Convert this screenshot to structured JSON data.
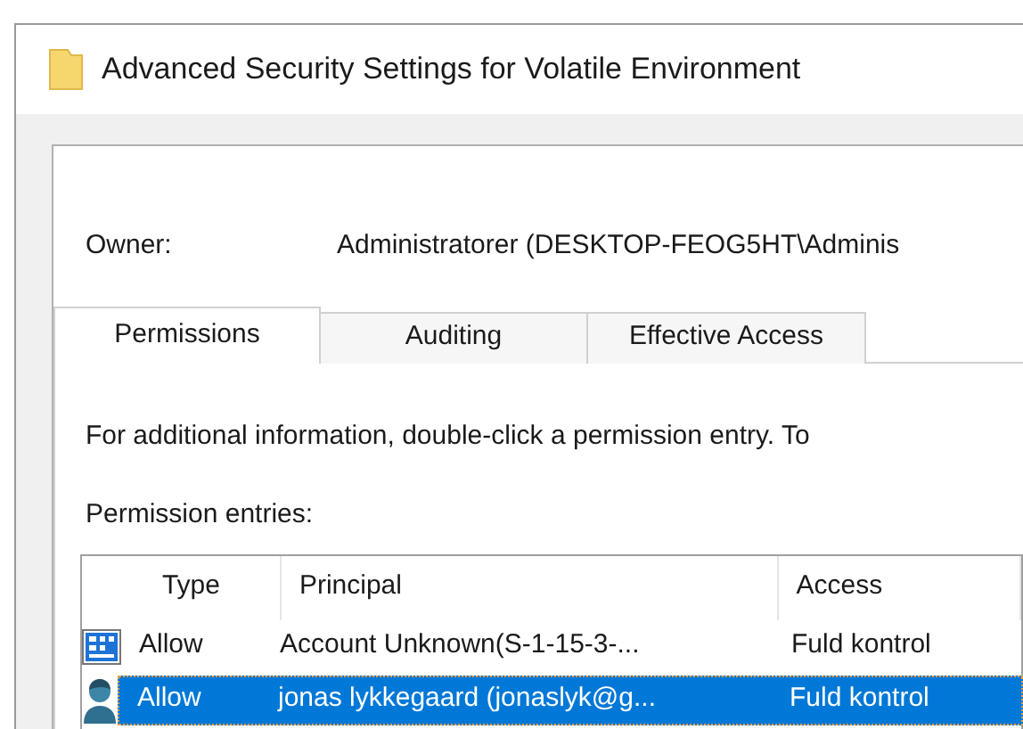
{
  "window": {
    "title": "Advanced Security Settings for Volatile Environment"
  },
  "owner": {
    "label": "Owner:",
    "value": "Administratorer (DESKTOP-FEOG5HT\\Adminis"
  },
  "tabs": [
    {
      "label": "Permissions",
      "selected": true
    },
    {
      "label": "Auditing",
      "selected": false
    },
    {
      "label": "Effective Access",
      "selected": false
    }
  ],
  "info_text": "For additional information, double-click a permission entry. To",
  "entries_label": "Permission entries:",
  "table": {
    "columns": [
      "Type",
      "Principal",
      "Access"
    ],
    "rows": [
      {
        "kind": "package",
        "type": "Allow",
        "principal": "Account Unknown(S-1-15-3-...",
        "access": "Fuld kontrol",
        "selected": false
      },
      {
        "kind": "user",
        "type": "Allow",
        "principal": "jonas lykkegaard (jonaslyk@g...",
        "access": "Fuld kontrol",
        "selected": true
      }
    ]
  }
}
